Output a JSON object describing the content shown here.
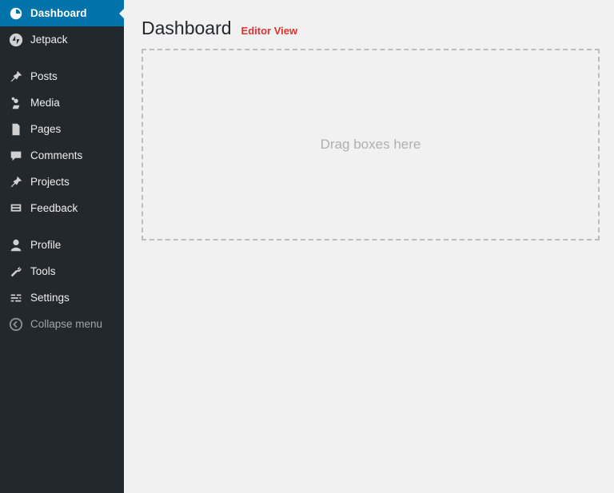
{
  "sidebar": {
    "items": [
      {
        "id": "dashboard",
        "label": "Dashboard"
      },
      {
        "id": "jetpack",
        "label": "Jetpack"
      },
      {
        "id": "posts",
        "label": "Posts"
      },
      {
        "id": "media",
        "label": "Media"
      },
      {
        "id": "pages",
        "label": "Pages"
      },
      {
        "id": "comments",
        "label": "Comments"
      },
      {
        "id": "projects",
        "label": "Projects"
      },
      {
        "id": "feedback",
        "label": "Feedback"
      },
      {
        "id": "profile",
        "label": "Profile"
      },
      {
        "id": "tools",
        "label": "Tools"
      },
      {
        "id": "settings",
        "label": "Settings"
      }
    ],
    "collapse_label": "Collapse menu"
  },
  "header": {
    "title": "Dashboard",
    "editor_view": "Editor View"
  },
  "dropzone": {
    "placeholder": "Drag boxes here"
  }
}
